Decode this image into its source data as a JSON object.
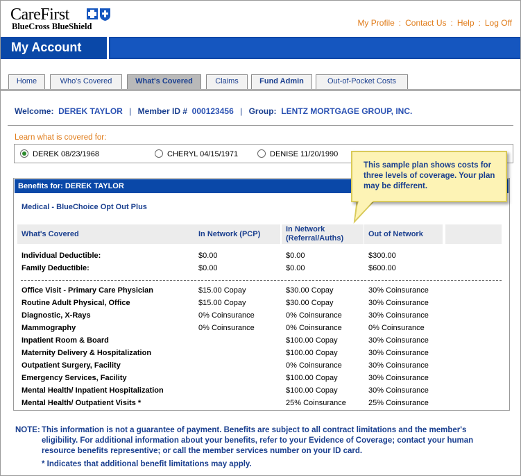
{
  "brand": {
    "logo_word": "CareFirst",
    "logo_sub": "BlueCross BlueShield"
  },
  "top_links": [
    "My Profile",
    "Contact Us",
    "Help",
    "Log Off"
  ],
  "title": "My Account",
  "tabs": [
    {
      "label": "Home"
    },
    {
      "label": "Who's Covered"
    },
    {
      "label": "What's Covered",
      "active": true
    },
    {
      "label": "Claims"
    },
    {
      "label": "Fund Admin"
    },
    {
      "label": "Out-of-Pocket Costs"
    }
  ],
  "welcome": {
    "welcome_label": "Welcome:",
    "member_name": "DEREK TAYLOR",
    "member_id_label": "Member ID #",
    "member_id": "000123456",
    "group_label": "Group:",
    "group_name": "LENTZ MORTGAGE GROUP, INC."
  },
  "learn_label": "Learn what is covered for:",
  "members": [
    {
      "label": "DEREK 08/23/1968",
      "selected": true
    },
    {
      "label": "CHERYL 04/15/1971",
      "selected": false
    },
    {
      "label": "DENISE 11/20/1990",
      "selected": false
    }
  ],
  "callout": "This sample plan shows costs for three levels of coverage. Your plan may be different.",
  "benefits": {
    "header": "Benefits for: DEREK TAYLOR",
    "plan": "Medical - BlueChoice Opt Out Plus",
    "columns": {
      "what": "What's Covered",
      "pcp": "In Network (PCP)",
      "ref_line1": "In Network",
      "ref_line2": "(Referral/Auths)",
      "oon": "Out of Network"
    },
    "deductibles": [
      {
        "label": "Individual Deductible:",
        "pcp": "$0.00",
        "ref": "$0.00",
        "oon": "$300.00"
      },
      {
        "label": "Family Deductible:",
        "pcp": "$0.00",
        "ref": "$0.00",
        "oon": "$600.00"
      }
    ],
    "services": [
      {
        "label": "Office Visit - Primary Care Physician",
        "pcp": "$15.00 Copay",
        "ref": "$30.00 Copay",
        "oon": "30% Coinsurance"
      },
      {
        "label": "Routine Adult Physical, Office",
        "pcp": "$15.00 Copay",
        "ref": "$30.00 Copay",
        "oon": "30% Coinsurance"
      },
      {
        "label": "Diagnostic, X-Rays",
        "pcp": "0% Coinsurance",
        "ref": "0% Coinsurance",
        "oon": "30% Coinsurance"
      },
      {
        "label": "Mammography",
        "pcp": "0% Coinsurance",
        "ref": "0% Coinsurance",
        "oon": "0% Coinsurance"
      },
      {
        "label": "Inpatient Room & Board",
        "pcp": "",
        "ref": "$100.00 Copay",
        "oon": "30% Coinsurance"
      },
      {
        "label": "Maternity Delivery & Hospitalization",
        "pcp": "",
        "ref": "$100.00 Copay",
        "oon": "30% Coinsurance"
      },
      {
        "label": "Outpatient Surgery, Facility",
        "pcp": "",
        "ref": "0% Coinsurance",
        "oon": "30% Coinsurance"
      },
      {
        "label": "Emergency Services, Facility",
        "pcp": "",
        "ref": "$100.00 Copay",
        "oon": "30% Coinsurance"
      },
      {
        "label": "Mental Health/ Inpatient Hospitalization",
        "pcp": "",
        "ref": "$100.00 Copay",
        "oon": "30% Coinsurance"
      },
      {
        "label": "Mental Health/ Outpatient Visits *",
        "pcp": "",
        "ref": "25% Coinsurance",
        "oon": "25% Coinsurance"
      }
    ]
  },
  "note": {
    "label": "NOTE:",
    "body": "This information is not a guarantee of payment.   Benefits are subject to all contract limitations and the member's eligibility.   For additional information about your benefits, refer to your Evidence of Coverage; contact your human resource benefits representive; or call the member services number on your ID card.",
    "star": "* Indicates that additional benefit limitations may apply."
  },
  "colors": {
    "brand_blue": "#0a48a8",
    "link_orange": "#e07b18",
    "text_blue": "#1a3f8f",
    "callout_bg": "#fdf3b5"
  }
}
